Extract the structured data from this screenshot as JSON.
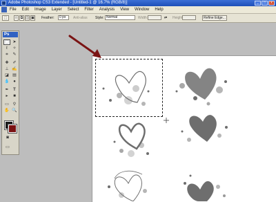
{
  "window": {
    "title": "Adobe Photoshop CS3 Extended - [Untitled-1 @ 16.7% (RGB/8)]",
    "minimize": "_",
    "maximize": "□",
    "close": "x"
  },
  "menu": {
    "items": [
      "File",
      "Edit",
      "Image",
      "Layer",
      "Select",
      "Filter",
      "Analysis",
      "View",
      "Window",
      "Help"
    ]
  },
  "options_bar": {
    "feather_label": "Feather:",
    "feather_value": "0 px",
    "anti_alias_label": "Anti-alias",
    "style_label": "Style:",
    "style_value": "Normal",
    "width_label": "Width:",
    "height_label": "Height:",
    "refine_edge": "Refine Edge..."
  },
  "toolbox": {
    "logo": "Ps",
    "foreground_color": "#1a1a1a",
    "background_color": "#7a1212"
  },
  "canvas": {
    "arrow_color": "#7a1414",
    "brush_color": "#6e6e6e"
  }
}
